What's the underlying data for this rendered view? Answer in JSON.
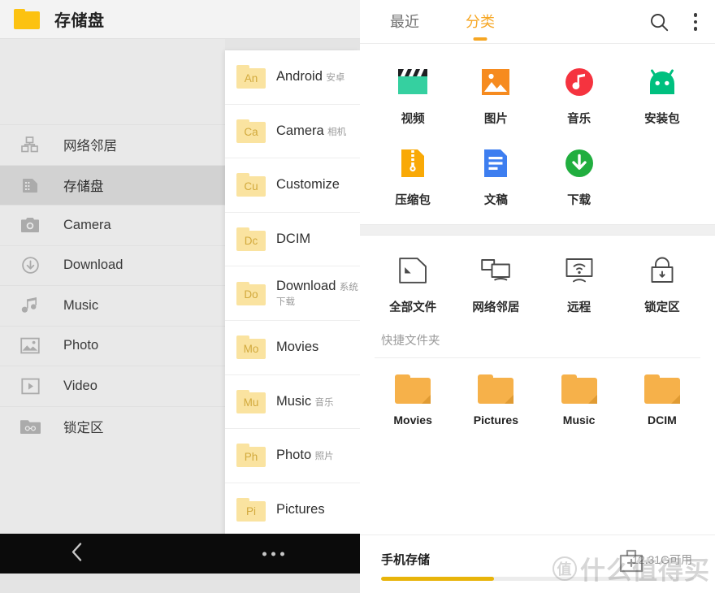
{
  "left_phone": {
    "titlebar": {
      "icon": "folder-icon",
      "title": "存储盘"
    },
    "nav_items": [
      {
        "icon": "network-neighborhood-icon",
        "label": "网络邻居",
        "active": false
      },
      {
        "icon": "storage-disk-icon",
        "label": "存储盘",
        "active": true
      },
      {
        "icon": "camera-icon",
        "label": "Camera",
        "active": false
      },
      {
        "icon": "download-icon",
        "label": "Download",
        "active": false
      },
      {
        "icon": "music-note-icon",
        "label": "Music",
        "active": false
      },
      {
        "icon": "photo-icon",
        "label": "Photo",
        "active": false
      },
      {
        "icon": "video-icon",
        "label": "Video",
        "active": false
      },
      {
        "icon": "locked-folder-icon",
        "label": "锁定区",
        "active": false
      }
    ],
    "folder_list": [
      {
        "abbr": "An",
        "name": "Android",
        "sub": "安卓"
      },
      {
        "abbr": "Ca",
        "name": "Camera",
        "sub": "相机"
      },
      {
        "abbr": "Cu",
        "name": "Customize",
        "sub": ""
      },
      {
        "abbr": "Dc",
        "name": "DCIM",
        "sub": ""
      },
      {
        "abbr": "Do",
        "name": "Download",
        "sub": "系统下载"
      },
      {
        "abbr": "Mo",
        "name": "Movies",
        "sub": ""
      },
      {
        "abbr": "Mu",
        "name": "Music",
        "sub": "音乐"
      },
      {
        "abbr": "Ph",
        "name": "Photo",
        "sub": "照片"
      },
      {
        "abbr": "Pi",
        "name": "Pictures",
        "sub": ""
      }
    ],
    "navbar": {
      "back": "back-chevron-icon",
      "more": "more-dots-icon"
    }
  },
  "right_phone": {
    "tabs": [
      {
        "label": "最近",
        "active": false
      },
      {
        "label": "分类",
        "active": true
      }
    ],
    "actions": [
      {
        "icon": "search-icon"
      },
      {
        "icon": "overflow-menu-icon"
      }
    ],
    "categories_primary": [
      {
        "icon": "video-clapper-icon",
        "label": "视频",
        "color": "#35d0a0"
      },
      {
        "icon": "picture-icon",
        "label": "图片",
        "color": "#f68b1f"
      },
      {
        "icon": "music-disc-icon",
        "label": "音乐",
        "color": "#f5333f"
      },
      {
        "icon": "android-apk-icon",
        "label": "安装包",
        "color": "#00c07f"
      },
      {
        "icon": "zip-archive-icon",
        "label": "压缩包",
        "color": "#f9a906"
      },
      {
        "icon": "document-icon",
        "label": "文稿",
        "color": "#3d7ef0"
      },
      {
        "icon": "download-circle-icon",
        "label": "下载",
        "color": "#21ae3f"
      }
    ],
    "categories_secondary": [
      {
        "icon": "all-files-icon",
        "label": "全部文件"
      },
      {
        "icon": "network-neighborhood-icon",
        "label": "网络邻居"
      },
      {
        "icon": "remote-screen-icon",
        "label": "远程"
      },
      {
        "icon": "lock-icon",
        "label": "锁定区"
      }
    ],
    "quick_folders": {
      "heading": "快捷文件夹",
      "items": [
        {
          "icon": "folder-icon",
          "label": "Movies"
        },
        {
          "icon": "folder-icon",
          "label": "Pictures"
        },
        {
          "icon": "folder-icon",
          "label": "Music"
        },
        {
          "icon": "folder-icon",
          "label": "DCIM"
        }
      ]
    },
    "storage": {
      "title": "手机存储",
      "free": "12.31G可用",
      "percent_used": 36,
      "bar_color": "#e8b40a"
    }
  },
  "watermark": {
    "circle": "值",
    "text": "什么值得买"
  }
}
